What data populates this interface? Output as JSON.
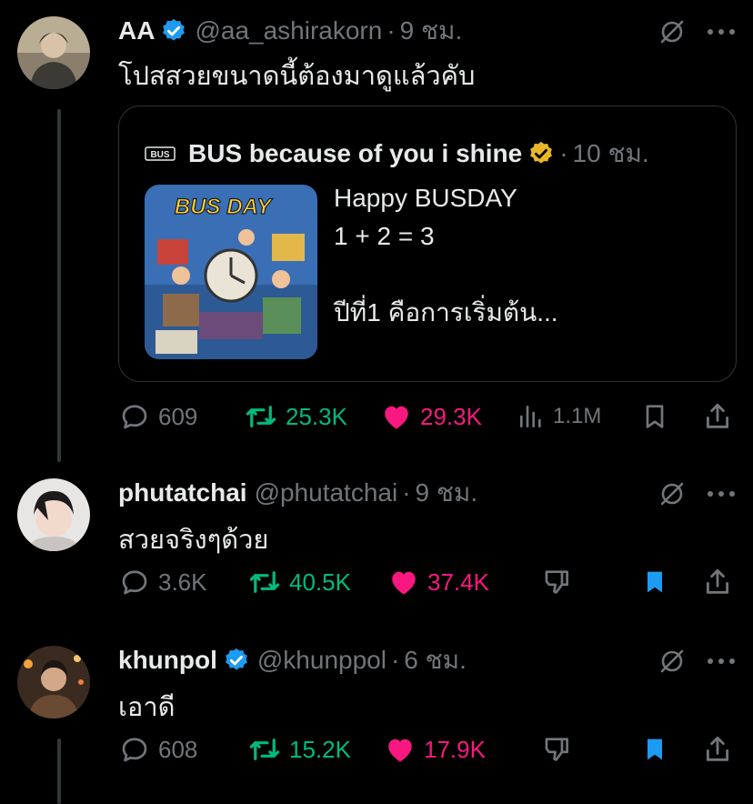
{
  "colors": {
    "background": "#000000",
    "text_primary": "#e7e9ea",
    "text_secondary": "#71767b",
    "retweet_green": "#00ba7c",
    "like_pink": "#f91880",
    "bookmark_blue": "#1d9bf0",
    "verified_blue": "#1d9bf0",
    "verified_gold": "#e8b829"
  },
  "main_post": {
    "author_name": "AA",
    "verified": "blue",
    "handle": "@aa_ashirakorn",
    "separator": "·",
    "time": "9 ชม.",
    "text": "โปสสวยขนาดนี้ต้องมาดูแล้วคับ",
    "quote": {
      "logo": "BUS",
      "author_name": "BUS because of you i shine",
      "verified": "gold",
      "separator": "·",
      "time": "10 ชม.",
      "image_title": "BUS DAY",
      "text_lines": [
        "Happy BUSDAY",
        "1 + 2 = 3",
        "",
        "ปีที่1 คือการเริ่มต้น..."
      ]
    },
    "actions": {
      "replies": "609",
      "reposts": "25.3K",
      "likes": "29.3K",
      "views": "1.1M",
      "bookmarked": false
    }
  },
  "replies": [
    {
      "author_name": "phutatchai",
      "verified": "none",
      "handle": "@phutatchai",
      "separator": "·",
      "time": "9 ชม.",
      "text": "สวยจริงๆด้วย",
      "actions": {
        "replies": "3.6K",
        "reposts": "40.5K",
        "likes": "37.4K",
        "bookmarked": true
      }
    },
    {
      "author_name": "khunpol",
      "verified": "blue",
      "handle": "@khunppol",
      "separator": "·",
      "time": "6 ชม.",
      "text": "เอาดี",
      "actions": {
        "replies": "608",
        "reposts": "15.2K",
        "likes": "17.9K",
        "bookmarked": true
      }
    }
  ]
}
